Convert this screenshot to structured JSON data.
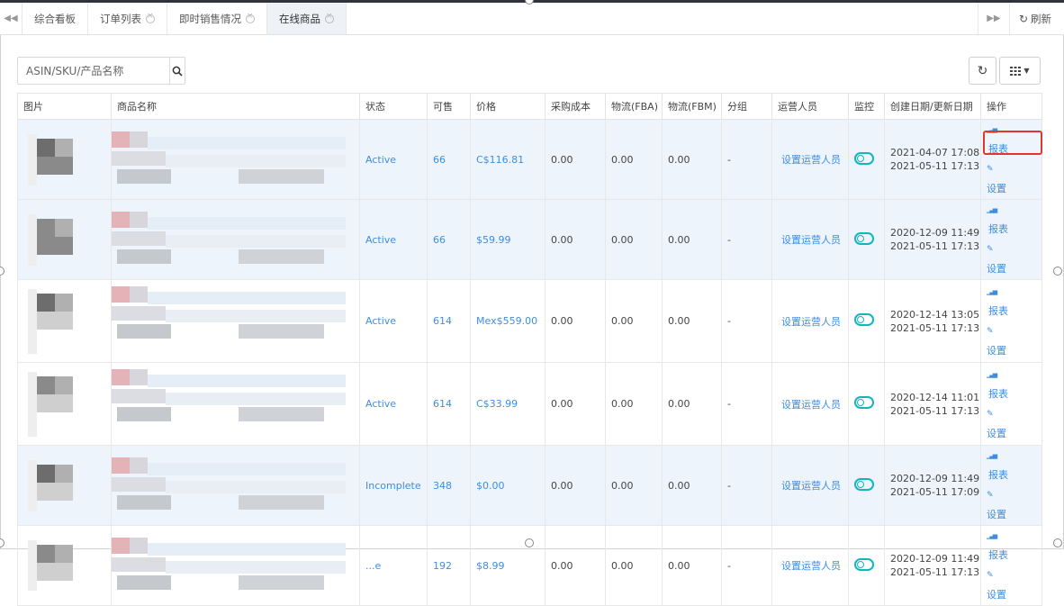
{
  "tabs": {
    "items": [
      {
        "label": "综合看板",
        "closable": false,
        "active": false
      },
      {
        "label": "订单列表",
        "closable": true,
        "active": false
      },
      {
        "label": "即时销售情况",
        "closable": true,
        "active": false
      },
      {
        "label": "在线商品",
        "closable": true,
        "active": true
      }
    ],
    "refresh_label": "刷新"
  },
  "search": {
    "placeholder": "ASIN/SKU/产品名称"
  },
  "columns": [
    "图片",
    "商品名称",
    "状态",
    "可售",
    "价格",
    "采购成本",
    "物流(FBA)",
    "物流(FBM)",
    "分组",
    "运营人员",
    "监控",
    "创建日期/更新日期",
    "操作"
  ],
  "rows": [
    {
      "status": "Active",
      "sellable": "66",
      "price": "C$116.81",
      "cost": "0.00",
      "fba": "0.00",
      "fbm": "0.00",
      "group": "-",
      "operator": "设置运营人员",
      "created": "2021-04-07 17:08",
      "updated": "2021-05-11 17:13",
      "report": "报表",
      "settings": "设置",
      "highlight": true
    },
    {
      "status": "Active",
      "sellable": "66",
      "price": "$59.99",
      "cost": "0.00",
      "fba": "0.00",
      "fbm": "0.00",
      "group": "-",
      "operator": "设置运营人员",
      "created": "2020-12-09 11:49",
      "updated": "2021-05-11 17:13",
      "report": "报表",
      "settings": "设置",
      "highlight": true
    },
    {
      "status": "Active",
      "sellable": "614",
      "price": "Mex$559.00",
      "cost": "0.00",
      "fba": "0.00",
      "fbm": "0.00",
      "group": "-",
      "operator": "设置运营人员",
      "created": "2020-12-14 13:05",
      "updated": "2021-05-11 17:13",
      "report": "报表",
      "settings": "设置",
      "highlight": false
    },
    {
      "status": "Active",
      "sellable": "614",
      "price": "C$33.99",
      "cost": "0.00",
      "fba": "0.00",
      "fbm": "0.00",
      "group": "-",
      "operator": "设置运营人员",
      "created": "2020-12-14 11:01",
      "updated": "2021-05-11 17:13",
      "report": "报表",
      "settings": "设置",
      "highlight": false
    },
    {
      "status": "Incomplete",
      "sellable": "348",
      "price": "$0.00",
      "cost": "0.00",
      "fba": "0.00",
      "fbm": "0.00",
      "group": "-",
      "operator": "设置运营人员",
      "created": "2020-12-09 11:49",
      "updated": "2021-05-11 17:09",
      "report": "报表",
      "settings": "设置",
      "highlight": true
    },
    {
      "status": "...e",
      "sellable": "192",
      "price": "$8.99",
      "cost": "0.00",
      "fba": "0.00",
      "fbm": "0.00",
      "group": "-",
      "operator": "设置运营人员",
      "created": "2020-12-09 11:49",
      "updated": "2021-05-11 17:13",
      "report": "报表",
      "settings": "设置",
      "highlight": false
    }
  ],
  "colors": {
    "link": "#3e8ee0",
    "toggle": "#14b3bd",
    "highlight_row": "#edf4fb",
    "annotation_box": "#e0362f"
  },
  "icons": {
    "search": "search-icon",
    "refresh": "refresh-icon",
    "columns": "grid-icon",
    "report": "bar-chart-icon",
    "settings": "edit-icon",
    "tab_left": "double-left-icon",
    "tab_right": "double-right-icon"
  }
}
